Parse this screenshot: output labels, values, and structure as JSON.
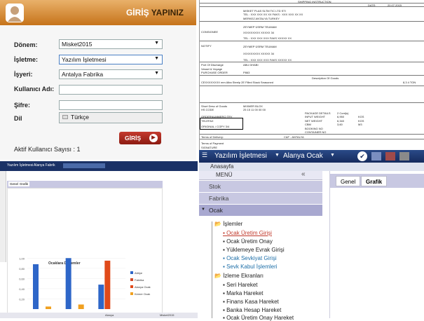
{
  "login": {
    "title_a": "GİRİŞ",
    "title_b": "YAPINIZ",
    "donem_label": "Dönem:",
    "donem_value": "Misket2015",
    "isletme_label": "İşletme:",
    "isletme_value": "Yazılım İşletmesi",
    "isyeri_label": "İşyeri:",
    "isyeri_value": "Antalya Fabrika",
    "user_label": "Kullanıcı Adı:",
    "pass_label": "Şifre:",
    "lang_label": "Dil",
    "lang_value": "Türkçe",
    "button": "GİRİŞ",
    "active_users": "Aktif Kullanıcı Sayısı : 1"
  },
  "doc": {
    "title": "SHIPPING INSTRUCTION",
    "date_label": "DATE:",
    "date": "20.07.2015",
    "shipper": "MISKET PLAS SLTM TIC LTD STI",
    "shipper_tel": "TEL : XXX XXX XX XX FAKS : XXX XXX XX XX",
    "shipper_addr": "MERKEZ ANTALYA TURKEY",
    "consignee_label": "CONSIGNEE",
    "consignee": "ZEYMEP ÜSRM TEUMAM",
    "consignee_2": "XXXXXXXXX XXXXX 34",
    "consignee_tel": "TEL : XXX XXX XXX FAKS XXXXX XX",
    "notify_label": "NOTIFY",
    "notify": "ZEYMEP ÜSRM TEUMAM",
    "notify_2": "XXXXXXXXX XXXXX 34",
    "notify_tel": "TEL : XXX XXX XXX FAKS XXXXX XX",
    "port_label": "Port Of Discharge",
    "port": "ABU DHABI",
    "vessel_label": "Vessel & Voyage",
    "purchase_label": "PURCHASE ORDER",
    "purchase": "P863",
    "goods_label": "Description Of Goods",
    "goods_line": "CEXXXXXXXX mm Alba Steelp 2E Filled Stack Seasoned",
    "goods_qty": "8,3 4  TON",
    "short_label": "Short Desc of Goods",
    "short": "MIXMER BLOX",
    "hs_label": "HS CODE",
    "hs": "25 15 11 00 00 00",
    "invoice_label": "COMMERCIAL INVOICE",
    "invoice": "2 Cont(s)",
    "packs_label": "PACKAGE DETAILS",
    "input_weight_label": "INPUT WEIGHT",
    "input_weight": "6,950",
    "input_unit": "KGS",
    "net_weight_label": "NET WEIGHT",
    "net_weight": "6,340",
    "net_unit": "KGS",
    "cbm_label": "CBM",
    "cbm": "3,60",
    "cbm_unit": "M3",
    "booking_label": "BOOKING NO",
    "container_label": "CONTAINER NO",
    "row1": "ORDERNUMMERO TRY",
    "row2": "TELEFAX",
    "row3": "ORIGINAL / COPY 3/4",
    "delivery_label": "Terms of Delivery:",
    "delivery": "C&F - ANTALYA",
    "footer1": "Terms of Payment",
    "footer2": "SIGNATURE"
  },
  "bl": {
    "app_label": "Yazılım İşletmesi",
    "branch": "Alanya Fabrik",
    "tab1": "Genel",
    "tab2": "Grafik",
    "chart_title": "Ocaklara Dönemler",
    "legend": [
      "Atölye",
      "Fabrika",
      "Alanya Ocak",
      "Kemer Ocak"
    ],
    "bottom1": "Alanya",
    "bottom2": "Misket2015"
  },
  "chart_data": {
    "type": "bar",
    "title": "Ocaklara Dönemler",
    "yticks": [
      "1,00",
      "0,80",
      "0,60",
      "0,40",
      "0,20"
    ],
    "categories": [
      "",
      "",
      ""
    ],
    "series": [
      {
        "name": "Atölye",
        "values": [
          0.88,
          1.0,
          0.48
        ]
      },
      {
        "name": "Alanya Ocak",
        "values": [
          0.0,
          0.0,
          0.95
        ]
      },
      {
        "name": "Kemer Ocak",
        "values": [
          0.05,
          0.09,
          0.0
        ]
      }
    ],
    "ylim": [
      0,
      1.1
    ]
  },
  "app": {
    "company": "Yazılım İşletmesi",
    "branch": "Alanya Ocak",
    "subtitle": "Anasayfa",
    "menu": "MENÜ",
    "sections": [
      "Stok",
      "Fabrika",
      "Ocak"
    ],
    "tab_genel": "Genel",
    "tab_grafik": "Grafik",
    "tree": [
      "İşlemler",
      "Ocak Üretim Girişi",
      "Ocak Üretim Onay",
      "Yüklemeye Evrak Girişi",
      "Ocak Sevkiyat Girişi",
      "Sevk Kabul İşlemleri",
      "İzleme Ekranları",
      "Seri Hareket",
      "Marka Hareket",
      "Finans Kasa Hareket",
      "Banka Hesap Hareket",
      "Ocak Üretim Onay Hareket"
    ]
  },
  "colors": {
    "accent": "#c6731a",
    "navy": "#1a3166",
    "menu": "#c8c8e2",
    "link_red": "#c0392b",
    "link_teal": "#1e6fa8"
  }
}
